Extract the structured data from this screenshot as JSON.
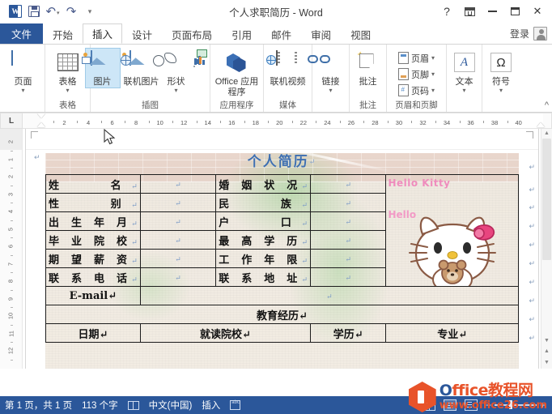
{
  "window": {
    "title": "个人求职简历 - Word",
    "quick_access": [
      {
        "name": "word-app-icon",
        "label": ""
      },
      {
        "name": "save-icon",
        "label": ""
      },
      {
        "name": "undo-icon",
        "label": "↶"
      },
      {
        "name": "redo-icon",
        "label": "↷"
      },
      {
        "name": "customize-qat-icon",
        "label": "▾"
      }
    ],
    "controls": {
      "help": "?",
      "ribbon_display": "",
      "minimize": "",
      "maximize": "",
      "close": "✕"
    }
  },
  "tabs": {
    "file": "文件",
    "items": [
      {
        "label": "开始",
        "active": false
      },
      {
        "label": "插入",
        "active": true
      },
      {
        "label": "设计",
        "active": false
      },
      {
        "label": "页面布局",
        "active": false
      },
      {
        "label": "引用",
        "active": false
      },
      {
        "label": "邮件",
        "active": false
      },
      {
        "label": "审阅",
        "active": false
      },
      {
        "label": "视图",
        "active": false
      }
    ],
    "signin": "登录"
  },
  "ribbon": {
    "groups": [
      {
        "label": "",
        "buttons": [
          {
            "label": "页面",
            "icon": "page-icon",
            "caret": "▾",
            "selected": false
          }
        ]
      },
      {
        "label": "表格",
        "buttons": [
          {
            "label": "表格",
            "icon": "table-icon",
            "caret": "▾",
            "selected": false
          }
        ]
      },
      {
        "label": "插图",
        "buttons": [
          {
            "label": "图片",
            "icon": "picture-icon",
            "caret": "",
            "selected": true
          },
          {
            "label": "联机图片",
            "icon": "online-picture-icon",
            "caret": "",
            "selected": false
          },
          {
            "label": "形状",
            "icon": "shapes-icon",
            "caret": "▾",
            "selected": false
          },
          {
            "label": "",
            "icon": "smartart-chart-icon",
            "caret": "▾",
            "selected": false
          }
        ]
      },
      {
        "label": "应用程序",
        "buttons": [
          {
            "label": "Office 应用程序",
            "icon": "office-apps-icon",
            "caret": "▾",
            "selected": false
          }
        ]
      },
      {
        "label": "媒体",
        "buttons": [
          {
            "label": "联机视频",
            "icon": "online-video-icon",
            "caret": "",
            "selected": false
          }
        ]
      },
      {
        "label": "",
        "buttons": [
          {
            "label": "链接",
            "icon": "link-icon",
            "caret": "▾",
            "selected": false
          }
        ]
      },
      {
        "label": "批注",
        "buttons": [
          {
            "label": "批注",
            "icon": "comment-icon",
            "caret": "",
            "selected": false
          }
        ]
      },
      {
        "label": "页眉和页脚",
        "small_buttons": [
          {
            "label": "页眉",
            "icon": "header-icon",
            "caret": "▾"
          },
          {
            "label": "页脚",
            "icon": "footer-icon",
            "caret": "▾"
          },
          {
            "label": "页码",
            "icon": "page-number-icon",
            "caret": "▾"
          }
        ]
      },
      {
        "label": "",
        "buttons": [
          {
            "label": "文本",
            "icon": "text-box-icon",
            "caret": "▾",
            "selected": false
          }
        ]
      },
      {
        "label": "",
        "buttons": [
          {
            "label": "符号",
            "icon": "symbol-icon",
            "caret": "▾",
            "selected": false
          }
        ]
      }
    ],
    "collapse_label": "^"
  },
  "ruler": {
    "corner_tab": "L",
    "h_ticks": [
      "2",
      "4",
      "6",
      "8",
      "10",
      "12",
      "14",
      "16",
      "18",
      "20",
      "22",
      "24",
      "26",
      "28",
      "30",
      "32",
      "34",
      "36",
      "38",
      "40"
    ],
    "v_ticks": [
      "2",
      "1",
      "2",
      "3",
      "4",
      "5",
      "6",
      "7",
      "8",
      "9",
      "10",
      "11",
      "12"
    ]
  },
  "document": {
    "title": "个人简历",
    "pilcrow": "↵",
    "table": {
      "rows": [
        {
          "label1": "姓　　名",
          "value1": "↵",
          "label2": "婚 姻 状 况",
          "value2": "↵"
        },
        {
          "label1": "性　　别",
          "value1": "↵",
          "label2": "民　　族",
          "value2": "↵"
        },
        {
          "label1": "出 生 年 月",
          "value1": "↵",
          "label2": "户　　口",
          "value2": "↵"
        },
        {
          "label1": "毕 业 院 校",
          "value1": "↵",
          "label2": "最 高 学 历",
          "value2": "↵"
        },
        {
          "label1": "期 望 薪 资",
          "value1": "↵",
          "label2": "工 作 年 限",
          "value2": "↵"
        },
        {
          "label1": "联 系 电 话",
          "value1": "↵",
          "label2": "联 系 地 址",
          "value2": "↵"
        }
      ],
      "email_label": "E-mail",
      "email_value": "↵",
      "section_title": "教育经历",
      "edu_headers": [
        "日期",
        "就读院校",
        "学历",
        "专业"
      ]
    },
    "photo_cell": {
      "brand_text": "Hello Kitty",
      "brand_text2": "Hello"
    }
  },
  "status_bar": {
    "page_info": "第 1 页，共 1 页",
    "word_count": "113 个字",
    "proofing_icon": "proofing-icon",
    "language": "中文(中国)",
    "insert_mode": "插入",
    "track_icon": "track-changes-icon",
    "views": [
      "read-mode-view",
      "print-layout-view",
      "web-layout-view"
    ],
    "zoom": {
      "minus": "−",
      "plus": "+"
    }
  },
  "watermark": {
    "line1_a": "O",
    "line1_b": "ffice教程网",
    "line2": "www.office26.com"
  }
}
